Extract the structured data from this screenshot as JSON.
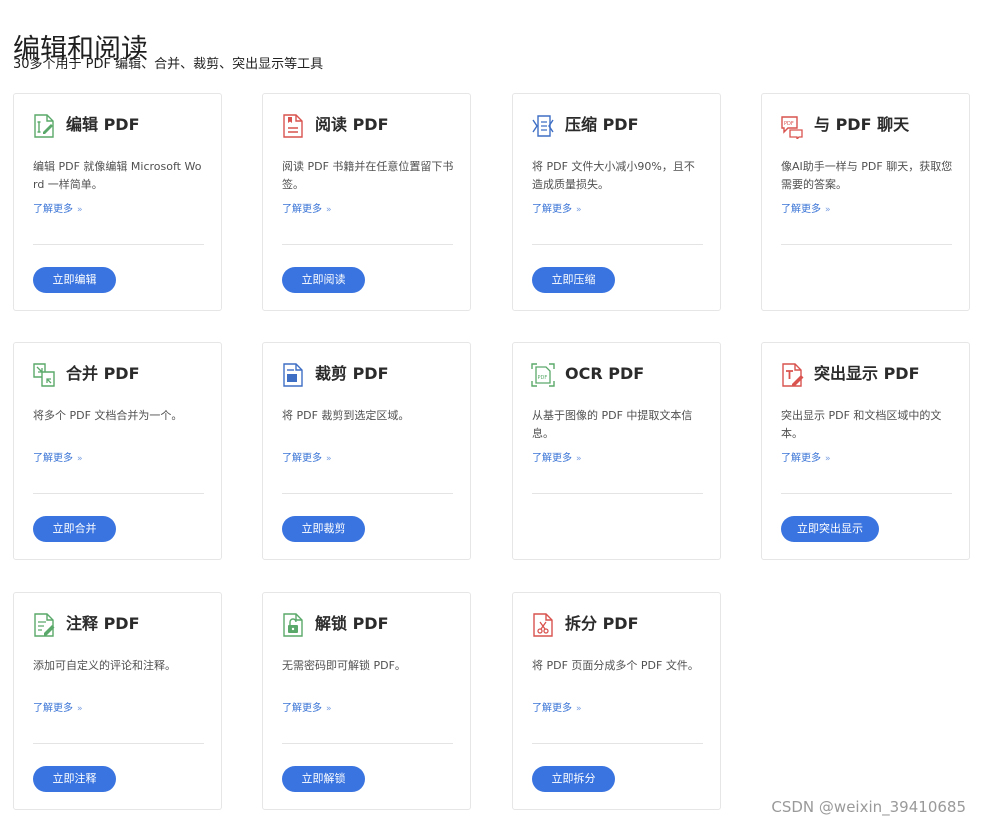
{
  "header": {
    "title": "编辑和阅读",
    "subtitle": "30多个用于 PDF 编辑、合并、裁剪、突出显示等工具"
  },
  "colors": {
    "accent": "#3a74e0",
    "link": "#3a74d6",
    "icon_green": "#5aa96a",
    "icon_red": "#d9534f",
    "icon_blue": "#3f6fc4"
  },
  "tools": [
    {
      "name": "编辑 PDF",
      "icon": "edit-pdf-icon",
      "desc": "编辑 PDF 就像编辑 Microsoft Word 一样简单。",
      "more": "了解更多",
      "cta": "立即编辑"
    },
    {
      "name": "阅读 PDF",
      "icon": "read-pdf-icon",
      "desc": "阅读 PDF 书籍并在任意位置留下书签。",
      "more": "了解更多",
      "cta": "立即阅读"
    },
    {
      "name": "压缩 PDF",
      "icon": "compress-pdf-icon",
      "desc": "将 PDF 文件大小减小90%，且不造成质量损失。",
      "more": "了解更多",
      "cta": "立即压缩"
    },
    {
      "name": "与 PDF 聊天",
      "icon": "chat-pdf-icon",
      "desc": "像AI助手一样与 PDF 聊天，获取您需要的答案。",
      "more": "了解更多",
      "cta": ""
    },
    {
      "name": "合并 PDF",
      "icon": "merge-pdf-icon",
      "desc": "将多个 PDF 文档合并为一个。",
      "more": "了解更多",
      "cta": "立即合并"
    },
    {
      "name": "裁剪 PDF",
      "icon": "crop-pdf-icon",
      "desc": "将 PDF 裁剪到选定区域。",
      "more": "了解更多",
      "cta": "立即裁剪"
    },
    {
      "name": "OCR PDF",
      "icon": "ocr-pdf-icon",
      "desc": "从基于图像的 PDF 中提取文本信息。",
      "more": "了解更多",
      "cta": ""
    },
    {
      "name": "突出显示 PDF",
      "icon": "highlight-pdf-icon",
      "desc": "突出显示 PDF 和文档区域中的文本。",
      "more": "了解更多",
      "cta": "立即突出显示"
    },
    {
      "name": "注释 PDF",
      "icon": "annotate-pdf-icon",
      "desc": "添加可自定义的评论和注释。",
      "more": "了解更多",
      "cta": "立即注释"
    },
    {
      "name": "解锁 PDF",
      "icon": "unlock-pdf-icon",
      "desc": "无需密码即可解锁 PDF。",
      "more": "了解更多",
      "cta": "立即解锁"
    },
    {
      "name": "拆分 PDF",
      "icon": "split-pdf-icon",
      "desc": "将 PDF 页面分成多个 PDF 文件。",
      "more": "了解更多",
      "cta": "立即拆分"
    }
  ],
  "watermark": "CSDN @weixin_39410685"
}
